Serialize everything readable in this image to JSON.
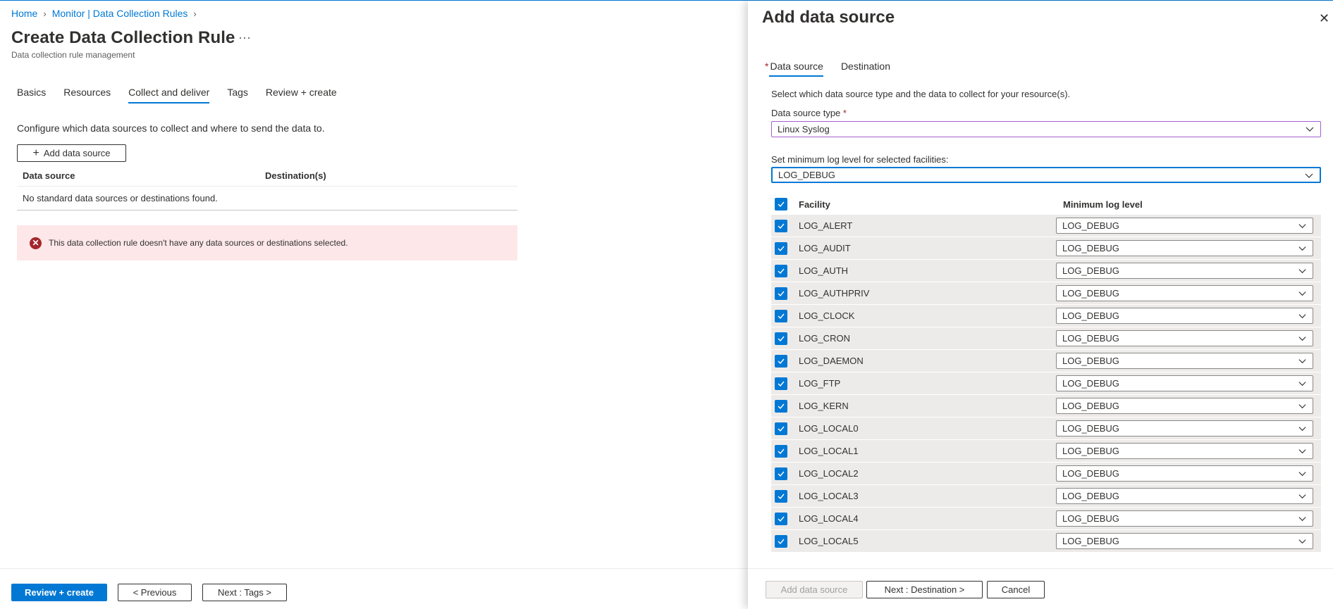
{
  "breadcrumb": {
    "home": "Home",
    "monitor": "Monitor | Data Collection Rules"
  },
  "page": {
    "title": "Create Data Collection Rule",
    "more": "···",
    "subtitle": "Data collection rule management"
  },
  "tabs": [
    "Basics",
    "Resources",
    "Collect and deliver",
    "Tags",
    "Review + create"
  ],
  "collect": {
    "description": "Configure which data sources to collect and where to send the data to.",
    "add_button": "Add data source",
    "col_source": "Data source",
    "col_dest": "Destination(s)",
    "empty": "No standard data sources or destinations found.",
    "error": "This data collection rule doesn't have any data sources or destinations selected."
  },
  "footer": {
    "review": "Review + create",
    "previous": "< Previous",
    "next": "Next : Tags >"
  },
  "panel": {
    "title": "Add data source",
    "tab_source": "Data source",
    "tab_dest": "Destination",
    "description": "Select which data source type and the data to collect for your resource(s).",
    "type_label": "Data source type",
    "type_value": "Linux Syslog",
    "level_label": "Set minimum log level for selected facilities:",
    "level_value": "LOG_DEBUG",
    "col_facility": "Facility",
    "col_level": "Minimum log level",
    "rows": [
      {
        "facility": "LOG_ALERT",
        "level": "LOG_DEBUG"
      },
      {
        "facility": "LOG_AUDIT",
        "level": "LOG_DEBUG"
      },
      {
        "facility": "LOG_AUTH",
        "level": "LOG_DEBUG"
      },
      {
        "facility": "LOG_AUTHPRIV",
        "level": "LOG_DEBUG"
      },
      {
        "facility": "LOG_CLOCK",
        "level": "LOG_DEBUG"
      },
      {
        "facility": "LOG_CRON",
        "level": "LOG_DEBUG"
      },
      {
        "facility": "LOG_DAEMON",
        "level": "LOG_DEBUG"
      },
      {
        "facility": "LOG_FTP",
        "level": "LOG_DEBUG"
      },
      {
        "facility": "LOG_KERN",
        "level": "LOG_DEBUG"
      },
      {
        "facility": "LOG_LOCAL0",
        "level": "LOG_DEBUG"
      },
      {
        "facility": "LOG_LOCAL1",
        "level": "LOG_DEBUG"
      },
      {
        "facility": "LOG_LOCAL2",
        "level": "LOG_DEBUG"
      },
      {
        "facility": "LOG_LOCAL3",
        "level": "LOG_DEBUG"
      },
      {
        "facility": "LOG_LOCAL4",
        "level": "LOG_DEBUG"
      },
      {
        "facility": "LOG_LOCAL5",
        "level": "LOG_DEBUG"
      }
    ],
    "footer": {
      "add": "Add data source",
      "next": "Next : Destination >",
      "cancel": "Cancel"
    }
  },
  "colors": {
    "accent": "#0078d4",
    "error": "#a4262c",
    "error_bg": "#fde7e9"
  }
}
